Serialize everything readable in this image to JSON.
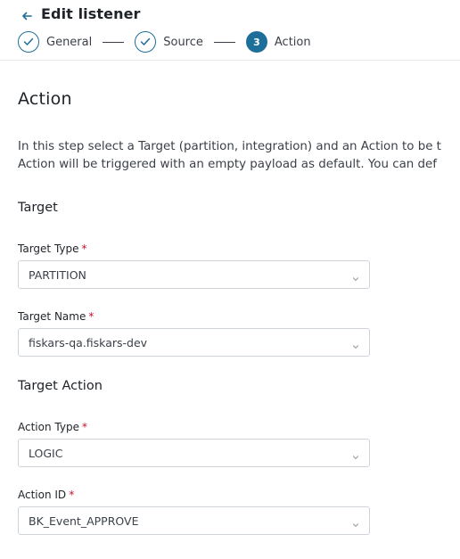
{
  "header": {
    "title": "Edit listener",
    "steps": [
      {
        "number": "1",
        "label": "General",
        "state": "done"
      },
      {
        "number": "2",
        "label": "Source",
        "state": "done"
      },
      {
        "number": "3",
        "label": "Action",
        "state": "active"
      }
    ]
  },
  "main": {
    "section_title": "Action",
    "description_line1": "In this step select a Target (partition, integration) and an Action to be t",
    "description_line2": "Action will be triggered with an empty payload as default. You can def",
    "target_group": {
      "title": "Target",
      "target_type": {
        "label": "Target Type",
        "required_mark": "*",
        "value": "PARTITION"
      },
      "target_name": {
        "label": "Target Name",
        "required_mark": "*",
        "value": "fiskars-qa.fiskars-dev"
      }
    },
    "action_group": {
      "title": "Target Action",
      "action_type": {
        "label": "Action Type",
        "required_mark": "*",
        "value": "LOGIC"
      },
      "action_id": {
        "label": "Action ID",
        "required_mark": "*",
        "value": "BK_Event_APPROVE"
      }
    }
  },
  "colors": {
    "accent": "#1d6e99",
    "required": "#c8102e",
    "border": "#cfd4da"
  },
  "icons": {
    "back": "arrow-left-icon",
    "step_done": "check-icon",
    "select": "chevron-down-icon"
  }
}
